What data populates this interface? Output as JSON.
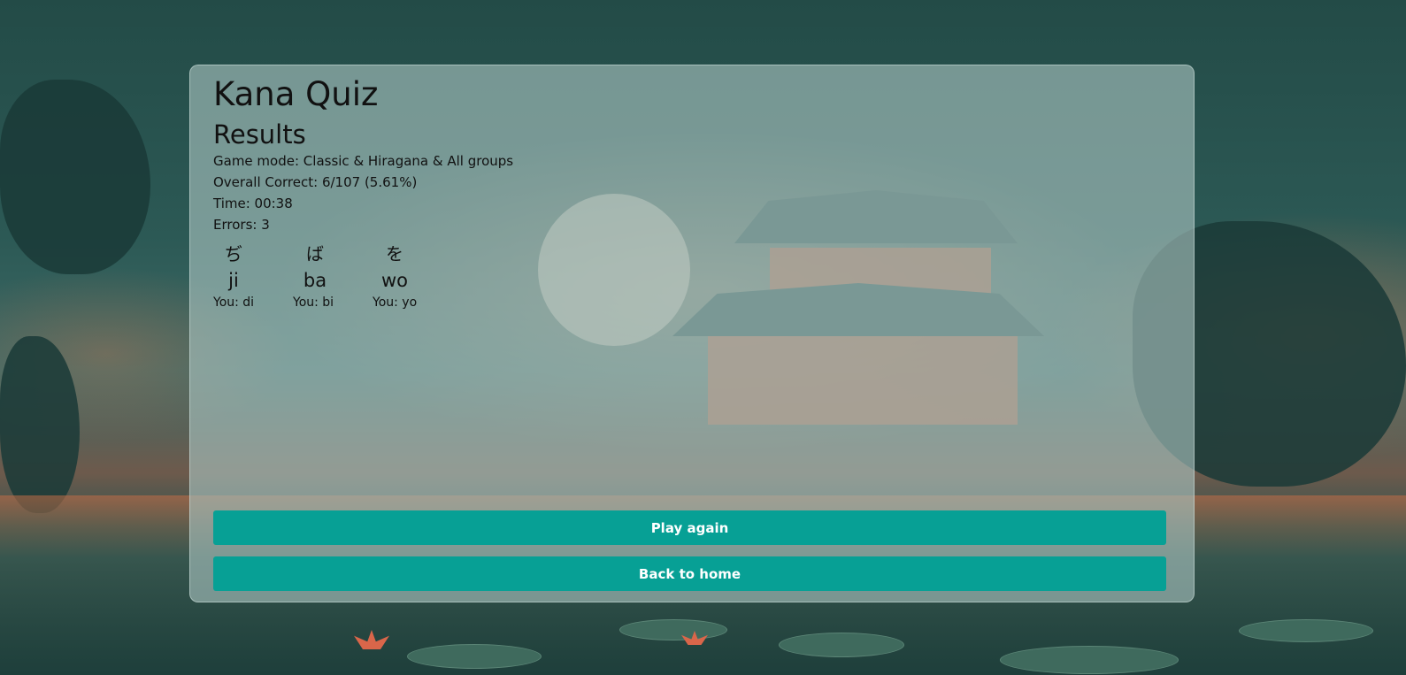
{
  "app": {
    "title": "Kana Quiz"
  },
  "results": {
    "heading": "Results",
    "game_mode_label": "Game mode: ",
    "game_mode_value": "Classic & Hiragana & All groups",
    "overall_label": "Overall Correct: ",
    "overall_value": "6/107 (5.61%)",
    "time_label": "Time: ",
    "time_value": "00:38",
    "errors_label": "Errors: ",
    "errors_value": "3"
  },
  "mistakes": [
    {
      "kana": "ぢ",
      "romaji": "ji",
      "you": "You: di"
    },
    {
      "kana": "ば",
      "romaji": "ba",
      "you": "You: bi"
    },
    {
      "kana": "を",
      "romaji": "wo",
      "you": "You: yo"
    }
  ],
  "actions": {
    "play_again": "Play again",
    "back_home": "Back to home"
  },
  "colors": {
    "button": "#07a095",
    "button_text": "#ffffff",
    "card_background": "rgba(170,195,192,0.62)"
  }
}
